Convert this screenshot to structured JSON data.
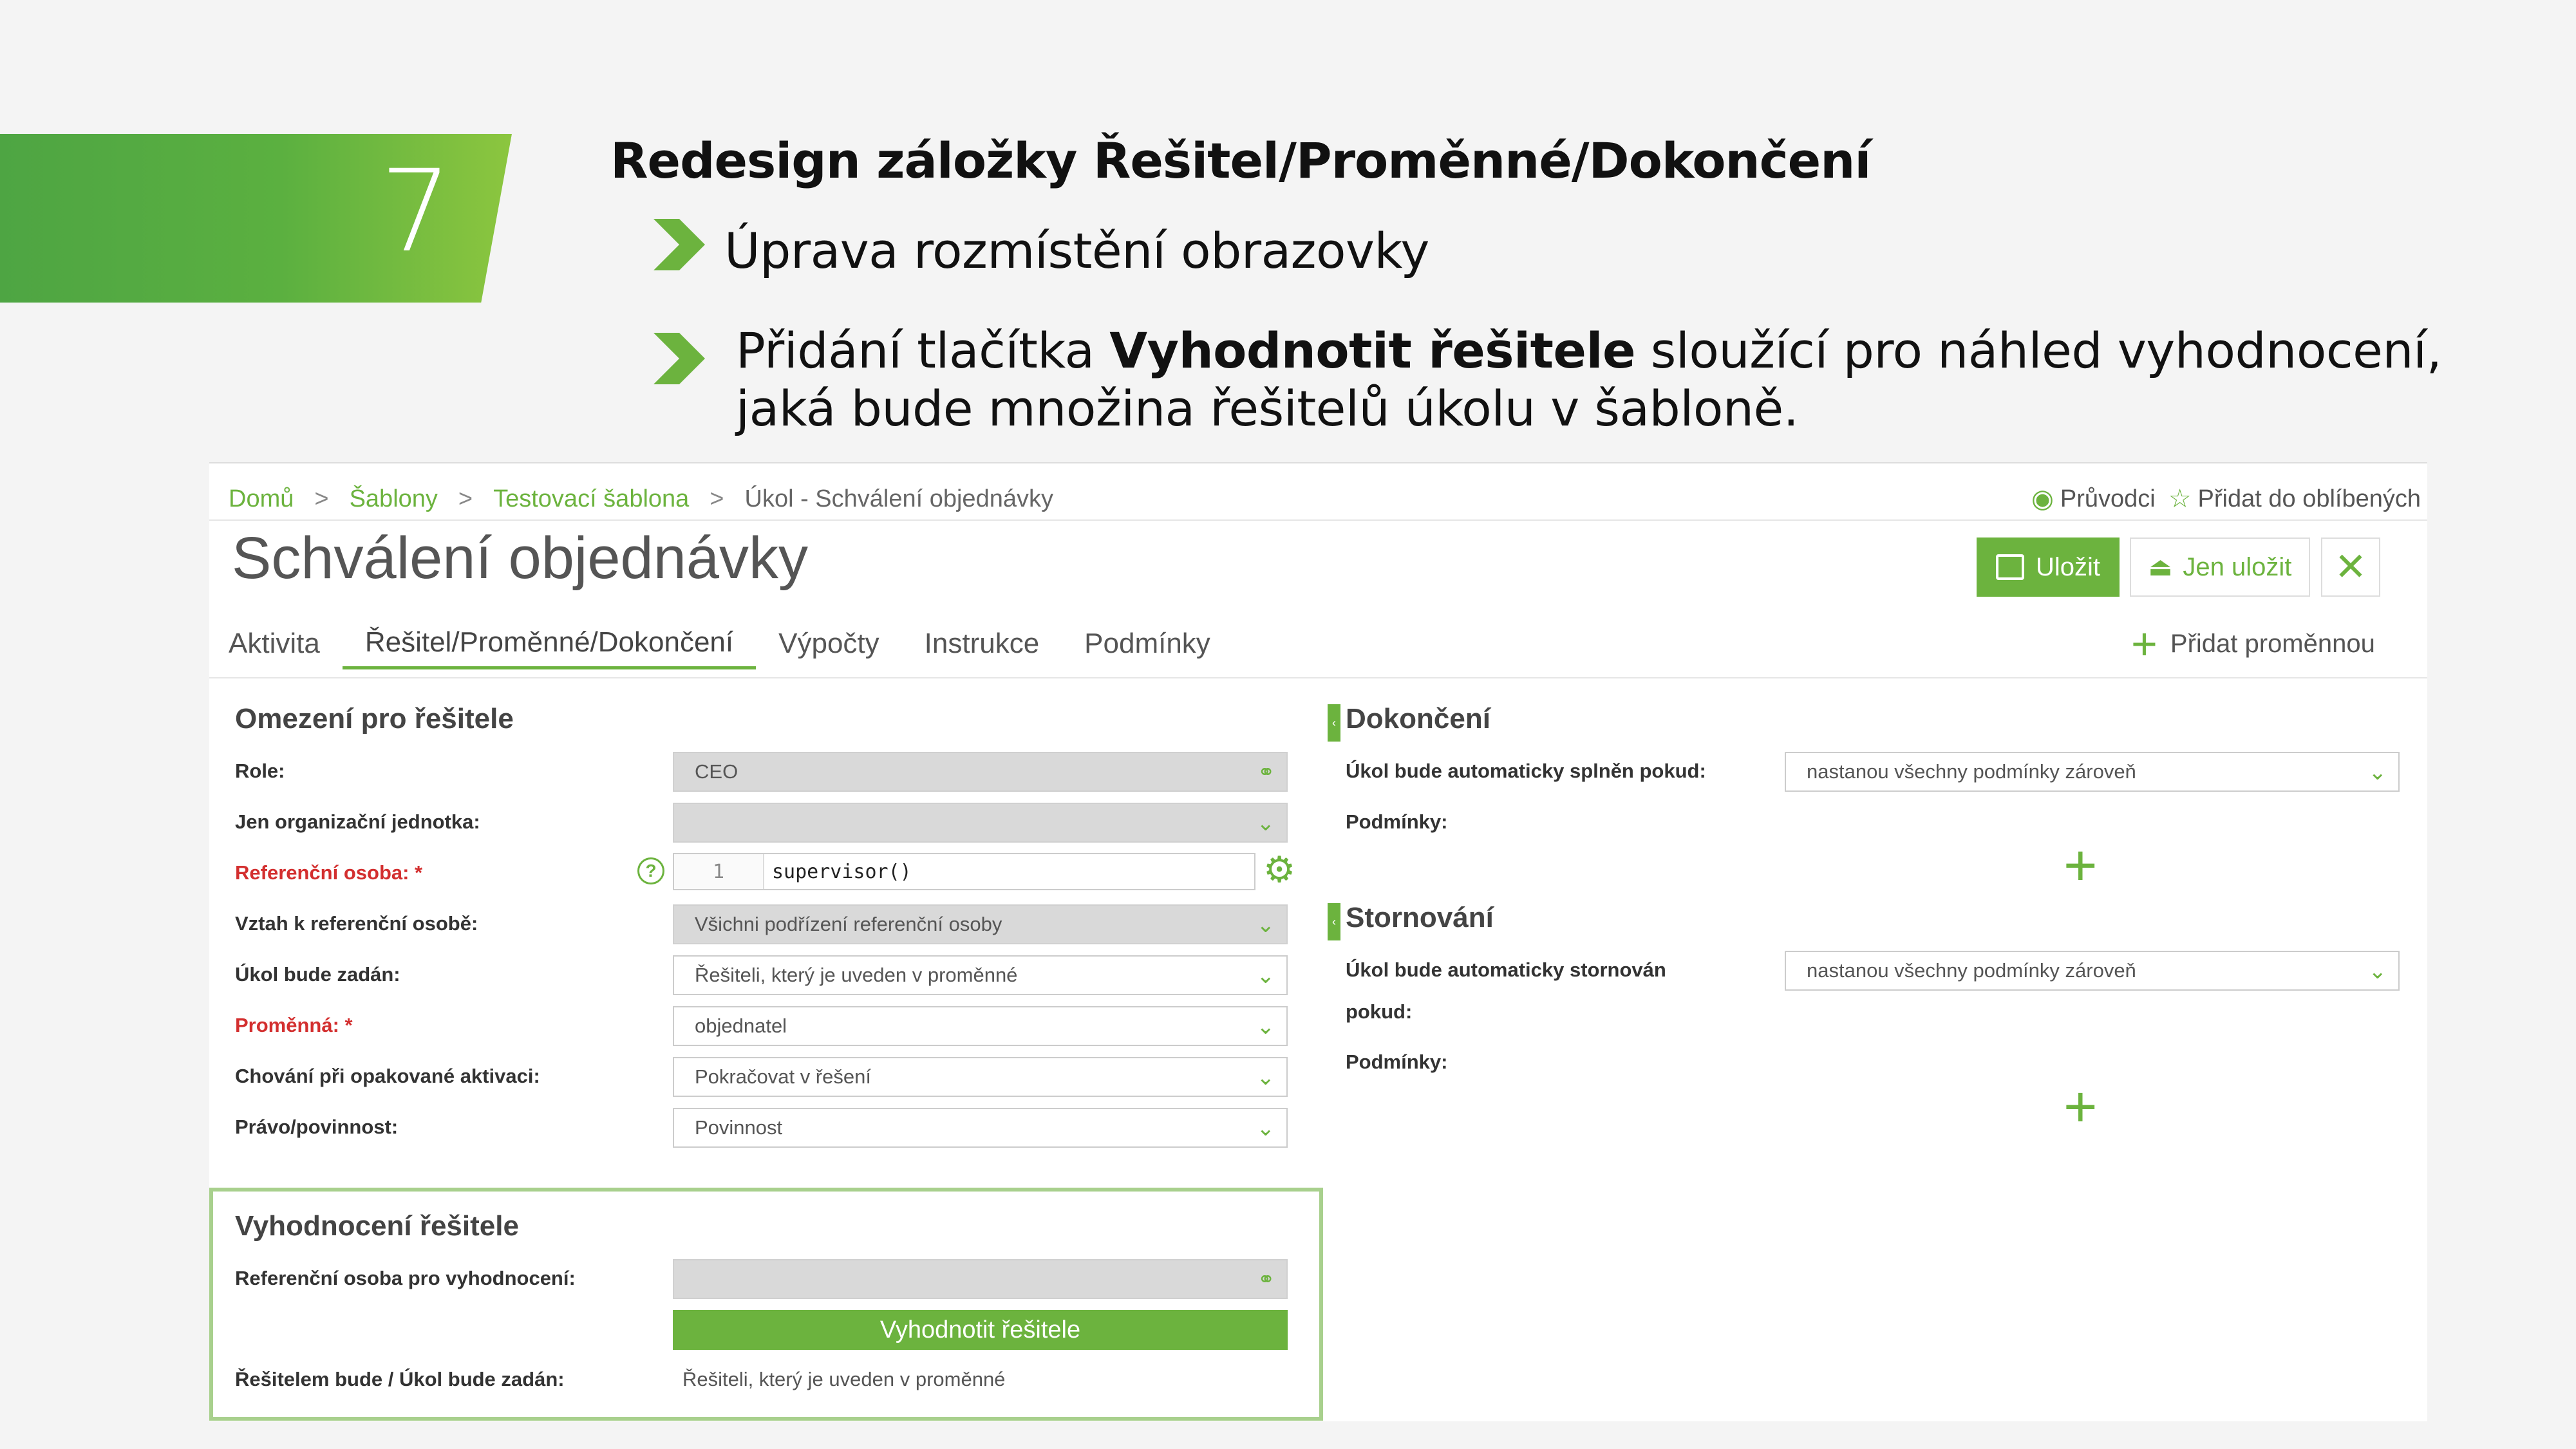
{
  "slide": {
    "number": "7",
    "title": "Redesign záložky Řešitel/Proměnné/Dokončení",
    "bullet1": "Úprava rozmístění obrazovky",
    "bullet2_prefix": "Přidání tlačítka ",
    "bullet2_bold": "Vyhodnotit řešitele",
    "bullet2_suffix": " sloužící pro náhled vyhodnocení,",
    "bullet2_line2": "jaká bude množina řešitelů úkolu v šabloně."
  },
  "colors": {
    "accent": "#6cb33e",
    "required": "#d32f2f",
    "eval_border": "#a8d08d"
  },
  "breadcrumb": {
    "items": [
      "Domů",
      "Šablony",
      "Testovací šablona",
      "Úkol - Schválení objednávky"
    ],
    "separator": ">"
  },
  "topright": {
    "guides": "Průvodci",
    "favorite": "Přidat do oblíbených",
    "guides_icon": "eye-icon",
    "favorite_icon": "star-icon"
  },
  "page": {
    "title": "Schválení objednávky"
  },
  "toolbar": {
    "save": "Uložit",
    "save_only": "Jen uložit"
  },
  "tabs": [
    "Aktivita",
    "Řešitel/Proměnné/Dokončení",
    "Výpočty",
    "Instrukce",
    "Podmínky"
  ],
  "add_variable": "Přidat proměnnou",
  "restrictions": {
    "title": "Omezení pro řešitele",
    "role_label": "Role:",
    "role_value": "CEO",
    "org_label": "Jen organizační jednotka:",
    "org_value": "",
    "ref_label": "Referenční osoba: *",
    "ref_line": "1",
    "ref_code": "supervisor()",
    "rel_label": "Vztah k referenční osobě:",
    "rel_value": "Všichni podřízení referenční osoby",
    "assign_label": "Úkol bude zadán:",
    "assign_value": "Řešiteli, který je uveden v proměnné",
    "var_label": "Proměnná: *",
    "var_value": "objednatel",
    "repeat_label": "Chování při opakované aktivaci:",
    "repeat_value": "Pokračovat v řešení",
    "duty_label": "Právo/povinnost:",
    "duty_value": "Povinnost"
  },
  "evaluation": {
    "title": "Vyhodnocení řešitele",
    "ref_label": "Referenční osoba pro vyhodnocení:",
    "button": "Vyhodnotit řešitele",
    "result_label": "Řešitelem bude / Úkol bude zadán:",
    "result_value": "Řešiteli, který je uveden v proměnné"
  },
  "completion": {
    "title": "Dokončení",
    "auto_label": "Úkol bude automaticky splněn pokud:",
    "auto_value": "nastanou všechny podmínky zároveň",
    "cond_label": "Podmínky:"
  },
  "cancel": {
    "title": "Stornování",
    "auto_label": "Úkol bude automaticky stornován",
    "auto_label2": "pokud:",
    "auto_value": "nastanou všechny podmínky zároveň",
    "cond_label": "Podmínky:"
  }
}
